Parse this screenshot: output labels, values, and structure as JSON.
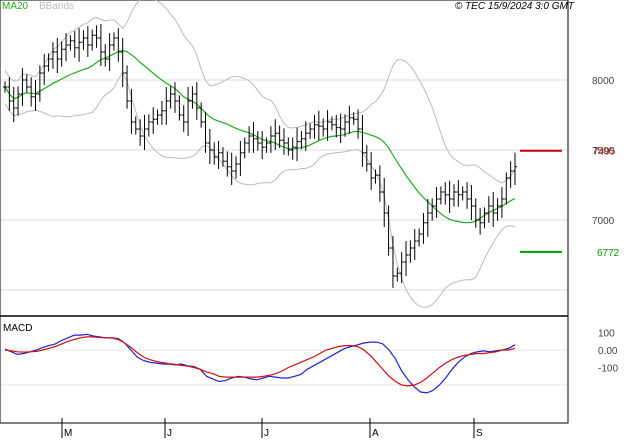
{
  "header": {
    "ma_label": "MA20",
    "bbands_label": "BBands",
    "copyright": "© TEC 15/9/2024 3:0 GMT"
  },
  "levels": {
    "resistance": {
      "label": "7495",
      "value": 7495,
      "color": "#cc0000"
    },
    "support": {
      "label": "6772",
      "value": 6772,
      "color": "#009900"
    }
  },
  "macd_panel": {
    "label": "MACD",
    "ticks": [
      "100",
      "0.00",
      "-100"
    ]
  },
  "colors": {
    "ma": "#22aa22",
    "bbands": "#bbbbbb",
    "macd": "#2222cc",
    "signal": "#cc1111",
    "bars": "#000000"
  },
  "chart_data": [
    {
      "type": "ohlc",
      "title": "",
      "x_months": [
        "M",
        "J",
        "J",
        "A",
        "S"
      ],
      "y_ticks": [
        "8000",
        "7500",
        "7000"
      ],
      "ylim": [
        6500,
        8600
      ],
      "close": [
        7950,
        7850,
        7800,
        7900,
        8000,
        7950,
        7880,
        7900,
        8050,
        8100,
        8150,
        8200,
        8150,
        8220,
        8250,
        8280,
        8230,
        8270,
        8300,
        8250,
        8320,
        8300,
        8200,
        8150,
        8250,
        8300,
        8200,
        8050,
        7850,
        7700,
        7650,
        7600,
        7650,
        7700,
        7720,
        7750,
        7780,
        7850,
        7900,
        7850,
        7750,
        7700,
        7850,
        7900,
        7800,
        7700,
        7550,
        7500,
        7450,
        7480,
        7420,
        7380,
        7350,
        7400,
        7480,
        7550,
        7600,
        7580,
        7550,
        7520,
        7550,
        7600,
        7620,
        7570,
        7550,
        7500,
        7520,
        7560,
        7580,
        7620,
        7650,
        7680,
        7670,
        7650,
        7700,
        7680,
        7660,
        7650,
        7700,
        7730,
        7720,
        7650,
        7480,
        7400,
        7300,
        7320,
        7200,
        7050,
        6800,
        6600,
        6620,
        6700,
        6750,
        6800,
        6850,
        6900,
        6980,
        7050,
        7100,
        7150,
        7200,
        7180,
        7150,
        7200,
        7180,
        7200,
        7150,
        7100,
        7000,
        6980,
        7050,
        7100,
        7050,
        7100,
        7150,
        7300,
        7350,
        7380
      ]
    },
    {
      "type": "line",
      "title": "",
      "series": [
        {
          "name": "MACD",
          "values": [
            5,
            -10,
            -25,
            -20,
            -10,
            0,
            15,
            25,
            35,
            55,
            70,
            85,
            85,
            90,
            80,
            75,
            70,
            70,
            65,
            40,
            0,
            -40,
            -60,
            -70,
            -75,
            -80,
            -80,
            -85,
            -80,
            -90,
            -95,
            -110,
            -150,
            -165,
            -180,
            -175,
            -160,
            -150,
            -155,
            -165,
            -170,
            -160,
            -150,
            -155,
            -160,
            -160,
            -150,
            -140,
            -110,
            -90,
            -70,
            -50,
            -30,
            -10,
            10,
            20,
            30,
            40,
            45,
            45,
            35,
            0,
            -50,
            -120,
            -170,
            -210,
            -240,
            -245,
            -230,
            -200,
            -160,
            -110,
            -70,
            -40,
            -20,
            -10,
            -5,
            -10,
            -5,
            0,
            10,
            30
          ]
        },
        {
          "name": "Signal",
          "values": [
            0,
            -5,
            -10,
            -12,
            -10,
            -8,
            0,
            10,
            20,
            35,
            50,
            60,
            70,
            75,
            75,
            72,
            70,
            68,
            60,
            40,
            15,
            -15,
            -40,
            -55,
            -65,
            -72,
            -78,
            -82,
            -88,
            -92,
            -100,
            -110,
            -125,
            -135,
            -150,
            -155,
            -155,
            -155,
            -155,
            -155,
            -155,
            -150,
            -145,
            -135,
            -120,
            -100,
            -85,
            -70,
            -55,
            -40,
            -20,
            0,
            10,
            20,
            25,
            25,
            20,
            0,
            -30,
            -70,
            -110,
            -150,
            -180,
            -200,
            -205,
            -200,
            -185,
            -160,
            -130,
            -100,
            -75,
            -55,
            -40,
            -30,
            -25,
            -20,
            -20,
            -15,
            -10,
            0,
            0,
            10
          ]
        }
      ],
      "ylim": [
        -300,
        200
      ]
    }
  ]
}
